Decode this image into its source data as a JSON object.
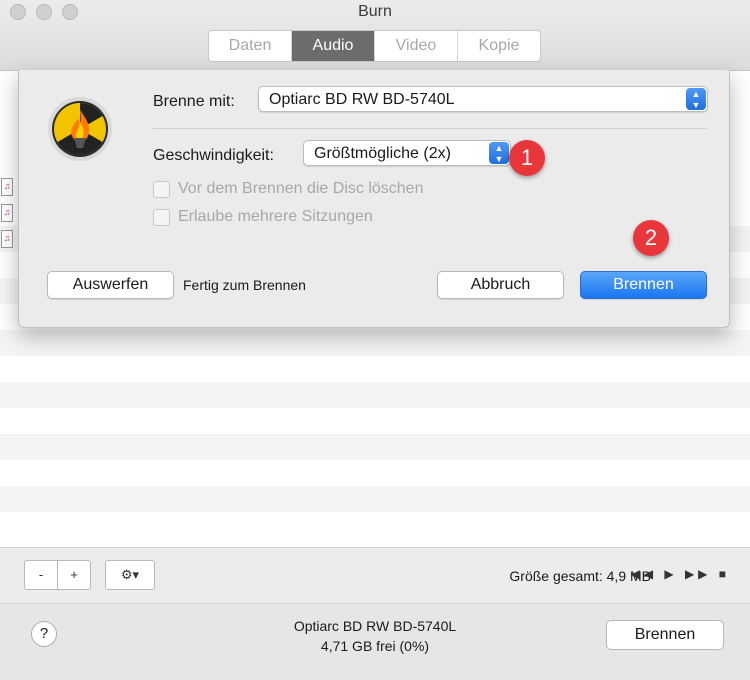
{
  "window": {
    "title": "Burn"
  },
  "tabs": [
    {
      "label": "Daten",
      "active": false
    },
    {
      "label": "Audio",
      "active": true
    },
    {
      "label": "Video",
      "active": false
    },
    {
      "label": "Kopie",
      "active": false
    }
  ],
  "sheet": {
    "burner_label": "Brenne mit:",
    "burner_value": "Optiarc BD RW BD-5740L",
    "speed_label": "Geschwindigkeit:",
    "speed_value": "Größtmögliche (2x)",
    "option_erase": "Vor dem Brennen die Disc löschen",
    "option_multisession": "Erlaube mehrere Sitzungen",
    "eject_button": "Auswerfen",
    "status": "Fertig zum Brennen",
    "cancel_button": "Abbruch",
    "burn_button": "Brennen",
    "badge_1": "1",
    "badge_2": "2"
  },
  "toolbar": {
    "remove_label": "-",
    "add_label": "+",
    "gear_label": "⚙▾",
    "total_size": "Größe gesamt: 4,9 MB",
    "transport": "◀◀ ▶ ▶▶ ■"
  },
  "footer": {
    "help_label": "?",
    "drive_name": "Optiarc BD RW BD-5740L",
    "drive_free": "4,71 GB frei (0%)",
    "burn_button": "Brennen"
  }
}
